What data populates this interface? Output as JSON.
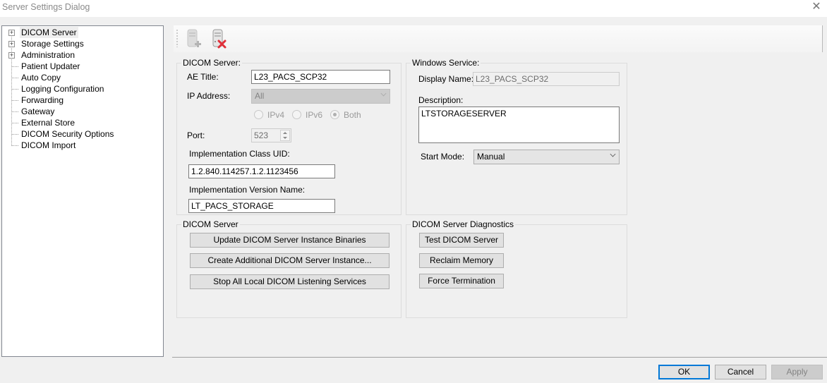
{
  "window": {
    "title": "Server Settings Dialog",
    "close_icon": "close-icon"
  },
  "tree": {
    "items": [
      {
        "label": "DICOM Server",
        "expandable": true,
        "selected": true
      },
      {
        "label": "Storage Settings",
        "expandable": true
      },
      {
        "label": "Administration",
        "expandable": true
      },
      {
        "label": "Patient Updater"
      },
      {
        "label": "Auto Copy"
      },
      {
        "label": "Logging Configuration"
      },
      {
        "label": "Forwarding"
      },
      {
        "label": "Gateway"
      },
      {
        "label": "External Store"
      },
      {
        "label": "DICOM Security Options"
      },
      {
        "label": "DICOM Import"
      }
    ],
    "expander_glyph": "+"
  },
  "toolbar": {
    "buttons": [
      {
        "icon": "add-server-icon",
        "enabled": false
      },
      {
        "icon": "delete-server-icon",
        "enabled": true
      }
    ]
  },
  "dicom_server": {
    "legend": "DICOM Server:",
    "ae_title_label": "AE Title:",
    "ae_title_value": "L23_PACS_SCP32",
    "ip_address_label": "IP Address:",
    "ip_address_value": "All",
    "ip_options": [
      {
        "label": "IPv4",
        "checked": false
      },
      {
        "label": "IPv6",
        "checked": false
      },
      {
        "label": "Both",
        "checked": true
      }
    ],
    "port_label": "Port:",
    "port_value": "523",
    "impl_class_uid_label": "Implementation Class UID:",
    "impl_class_uid_value": "1.2.840.114257.1.2.1123456",
    "impl_version_label": "Implementation Version Name:",
    "impl_version_value": "LT_PACS_STORAGE"
  },
  "windows_service": {
    "legend": "Windows Service:",
    "display_name_label": "Display Name:",
    "display_name_value": "L23_PACS_SCP32",
    "description_label": "Description:",
    "description_value": "LTSTORAGESERVER",
    "start_mode_label": "Start Mode:",
    "start_mode_value": "Manual"
  },
  "server_actions": {
    "legend": "DICOM Server",
    "buttons": [
      "Update DICOM Server Instance Binaries",
      "Create Additional DICOM Server Instance...",
      "Stop All Local DICOM Listening Services"
    ]
  },
  "diagnostics": {
    "legend": "DICOM Server Diagnostics",
    "buttons": [
      "Test DICOM Server",
      "Reclaim Memory",
      "Force Termination"
    ]
  },
  "footer": {
    "ok_label": "OK",
    "cancel_label": "Cancel",
    "apply_label": "Apply"
  },
  "colors": {
    "default_button_border": "#0078d7",
    "delete_icon": "#e0303a"
  }
}
